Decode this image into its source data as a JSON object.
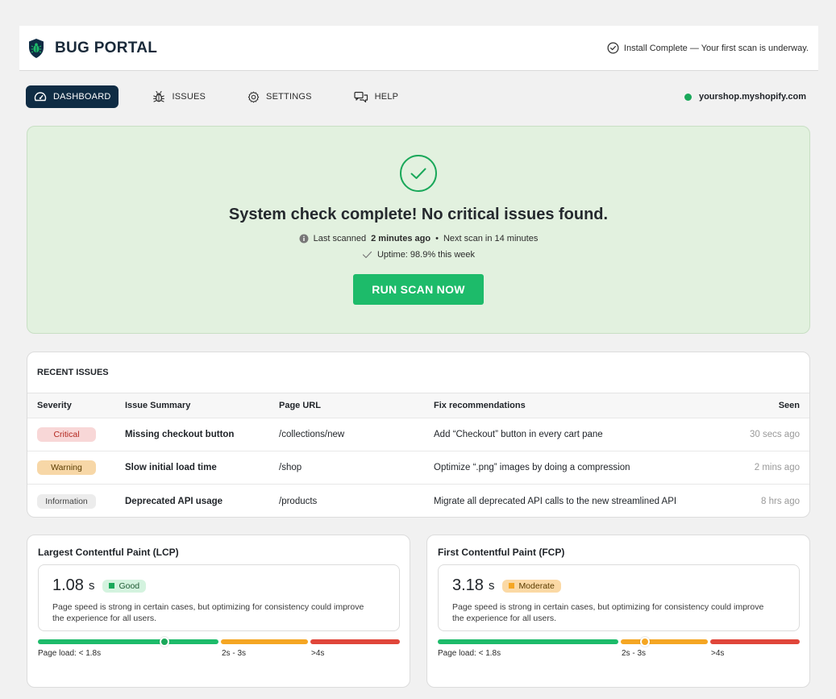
{
  "brand": {
    "name": "BUG PORTAL"
  },
  "install": {
    "text": "Install Complete — Your first scan is underway."
  },
  "nav": {
    "items": [
      {
        "label": "DASHBOARD",
        "icon": "gauge-icon",
        "active": true
      },
      {
        "label": "ISSUES",
        "icon": "bug-icon",
        "active": false
      },
      {
        "label": "SETTINGS",
        "icon": "gear-icon",
        "active": false
      },
      {
        "label": "HELP",
        "icon": "chat-icon",
        "active": false
      }
    ],
    "shop": "yourshop.myshopify.com"
  },
  "hero": {
    "title": "System check complete! No critical issues found.",
    "last_scanned_prefix": "Last scanned",
    "last_scanned_value": "2 minutes ago",
    "separator": "•",
    "next_scan": "Next scan in 14 minutes",
    "uptime": "Uptime: 98.9% this week",
    "button": "RUN SCAN NOW"
  },
  "issues": {
    "title": "RECENT ISSUES",
    "columns": [
      "Severity",
      "Issue Summary",
      "Page URL",
      "Fix recommendations",
      "Seen"
    ],
    "rows": [
      {
        "severity": "Critical",
        "summary": "Missing checkout button",
        "url": "/collections/new",
        "fix": "Add “Checkout” button in every cart pane",
        "seen": "30 secs ago"
      },
      {
        "severity": "Warning",
        "summary": "Slow initial load time",
        "url": "/shop",
        "fix": "Optimize “.png” images by doing a compression",
        "seen": "2 mins ago"
      },
      {
        "severity": "Information",
        "summary": "Deprecated API usage",
        "url": "/products",
        "fix": "Migrate all deprecated API calls to the new streamlined API",
        "seen": "8 hrs ago"
      }
    ]
  },
  "lcp": {
    "title": "Largest Contentful Paint (LCP)",
    "value": "1.08",
    "unit": "s",
    "status": "Good",
    "description": "Page speed is strong in certain cases, but optimizing for consistency could improve the experience for all users.",
    "labels": {
      "good": "Page load: < 1.8s",
      "mid": "2s - 3s",
      "bad": ">4s"
    }
  },
  "fcp": {
    "title": "First Contentful Paint (FCP)",
    "value": "3.18",
    "unit": "s",
    "status": "Moderate",
    "description": "Page speed is strong in certain cases, but optimizing for consistency could improve the experience for all users.",
    "labels": {
      "good": "Page load: < 1.8s",
      "mid": "2s - 3s",
      "bad": ">4s"
    }
  },
  "colors": {
    "brand": "#0f2c44",
    "success": "#1dbb6a",
    "warning": "#f5a623",
    "danger": "#e0463a"
  }
}
